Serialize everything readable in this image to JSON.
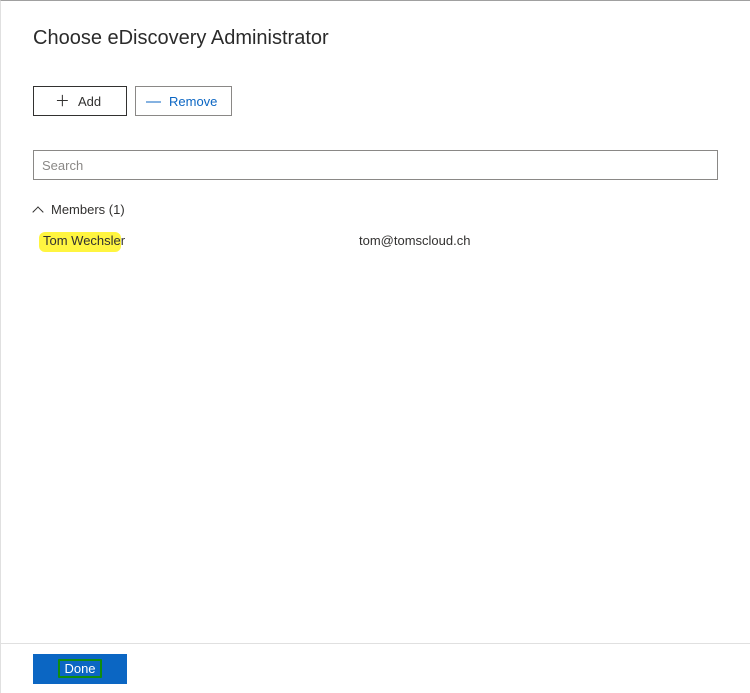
{
  "page": {
    "title": "Choose eDiscovery Administrator"
  },
  "buttons": {
    "add_label": "Add",
    "remove_label": "Remove",
    "done_label": "Done"
  },
  "search": {
    "placeholder": "Search",
    "value": ""
  },
  "members": {
    "header_label": "Members (1)",
    "items": [
      {
        "name": "Tom Wechsler",
        "email": "tom@tomscloud.ch"
      }
    ]
  }
}
